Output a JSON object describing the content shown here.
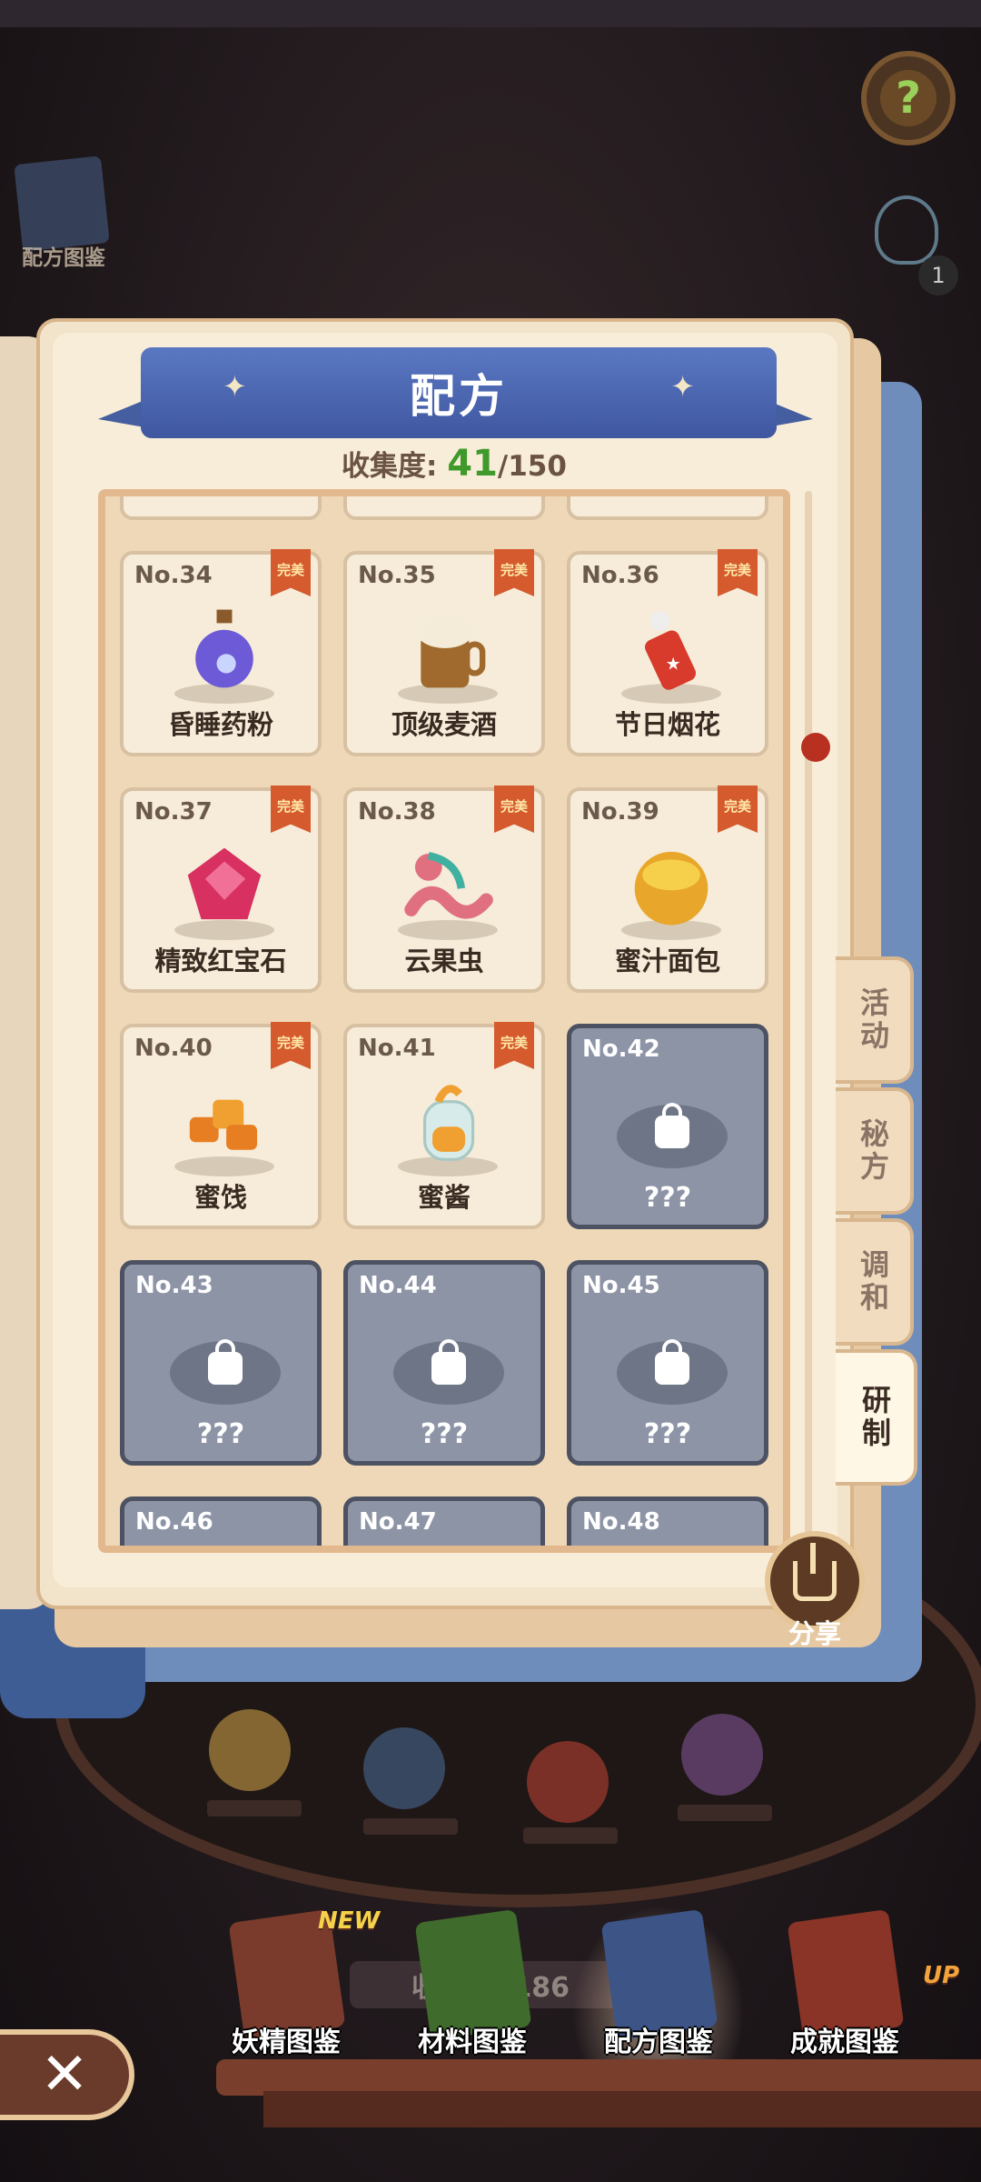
{
  "panel": {
    "title": "配方",
    "progress_label": "收集度:",
    "progress_current": "41",
    "progress_total": "/150"
  },
  "recipes": [
    {
      "number": "No.34",
      "name": "昏睡药粉",
      "badge": "完美",
      "icon": "purple-potion-icon",
      "unlocked": true
    },
    {
      "number": "No.35",
      "name": "顶级麦酒",
      "badge": "完美",
      "icon": "beer-mug-icon",
      "unlocked": true
    },
    {
      "number": "No.36",
      "name": "节日烟花",
      "badge": "完美",
      "icon": "firework-icon",
      "unlocked": true
    },
    {
      "number": "No.37",
      "name": "精致红宝石",
      "badge": "完美",
      "icon": "ruby-icon",
      "unlocked": true
    },
    {
      "number": "No.38",
      "name": "云果虫",
      "badge": "完美",
      "icon": "worm-icon",
      "unlocked": true
    },
    {
      "number": "No.39",
      "name": "蜜汁面包",
      "badge": "完美",
      "icon": "honey-bread-icon",
      "unlocked": true
    },
    {
      "number": "No.40",
      "name": "蜜饯",
      "badge": "完美",
      "icon": "candied-fruit-icon",
      "unlocked": true
    },
    {
      "number": "No.41",
      "name": "蜜酱",
      "badge": "完美",
      "icon": "honey-jar-icon",
      "unlocked": true
    },
    {
      "number": "No.42",
      "name": "???",
      "badge": "",
      "icon": "lock-icon",
      "unlocked": false
    },
    {
      "number": "No.43",
      "name": "???",
      "badge": "",
      "icon": "lock-icon",
      "unlocked": false
    },
    {
      "number": "No.44",
      "name": "???",
      "badge": "",
      "icon": "lock-icon",
      "unlocked": false
    },
    {
      "number": "No.45",
      "name": "???",
      "badge": "",
      "icon": "lock-icon",
      "unlocked": false
    },
    {
      "number": "No.46",
      "name": "",
      "badge": "",
      "icon": "lock-icon",
      "unlocked": false
    },
    {
      "number": "No.47",
      "name": "",
      "badge": "",
      "icon": "lock-icon",
      "unlocked": false
    },
    {
      "number": "No.48",
      "name": "",
      "badge": "",
      "icon": "lock-icon",
      "unlocked": false
    }
  ],
  "side_tabs": [
    {
      "label": "活动",
      "active": false
    },
    {
      "label": "秘方",
      "active": false
    },
    {
      "label": "调和",
      "active": false
    },
    {
      "label": "研制",
      "active": true
    }
  ],
  "share_label": "分享",
  "corner_book_label": "配方图鉴",
  "hint_count": "1",
  "help_label": "?",
  "bottom_nav": {
    "progress_pill": "收… …/186",
    "new_tag": "NEW",
    "up_tag": "UP",
    "items": [
      {
        "label": "妖精图鉴",
        "color": "#7a3b2c",
        "active": false
      },
      {
        "label": "材料图鉴",
        "color": "#3f6b2c",
        "active": false
      },
      {
        "label": "配方图鉴",
        "color": "#3d5486",
        "active": true
      },
      {
        "label": "成就图鉴",
        "color": "#8a3427",
        "active": false
      }
    ]
  },
  "colors": {
    "ribbon": "#4a64aa",
    "progress_current": "#3f9a2b",
    "perfect_badge": "#d55a2e",
    "locked_card": "#8d94a6"
  }
}
